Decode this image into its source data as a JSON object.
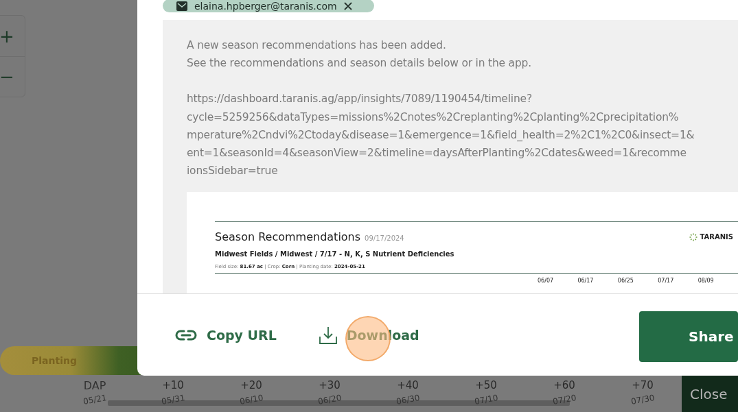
{
  "zoom_controls": [
    {
      "symbol": "+"
    },
    {
      "symbol": "−"
    }
  ],
  "timeline": {
    "phase": {
      "label": "Planting"
    },
    "dap_label": "DAP",
    "dap_ticks": [
      "+10",
      "+20",
      "+30",
      "+40",
      "+50",
      "+60",
      "+70"
    ],
    "dates": [
      "05/21",
      "05/31",
      "06/10",
      "06/20",
      "06/30",
      "07/10",
      "07/20",
      "07/30"
    ]
  },
  "close_button": "Close",
  "dialog": {
    "recipient": "elaina.hpberger@taranis.com",
    "message_lines": [
      "A new season recommendations has been added.",
      "See the recommendations and season details below or in the app."
    ],
    "url_lines": [
      "https://dashboard.taranis.ag/app/insights/7089/1190454/timeline?",
      "cycle=5259256&dataTypes=missions%2Cnotes%2Creplanting%2Cplanting%2Cprecipitation%",
      "mperature%2Cndvi%2Ctoday&disease=1&emergence=1&field_health=2%2C1%2C0&insect=1&",
      "ent=1&seasonId=4&seasonView=2&timeline=daysAfterPlanting%2Cdates&weed=1&recomme",
      "ionsSidebar=true"
    ],
    "preview": {
      "title": "Season Recommendations",
      "date": "09/17/2024",
      "logo": "TARANIS",
      "path": "Midwest Fields / Midwest / 7/17 - N, K, S Nutrient Deficiencies",
      "meta": "Field size: **81.67 ac** | Crop: **Corn** | Planting date: **2024-05-21**",
      "columns": [
        "06/07",
        "06/17",
        "06/25",
        "07/17",
        "08/09"
      ]
    },
    "actions": [
      {
        "kind": "copy",
        "label": "Copy URL"
      },
      {
        "kind": "download",
        "label": "Download"
      }
    ],
    "primary_button": "Share"
  }
}
